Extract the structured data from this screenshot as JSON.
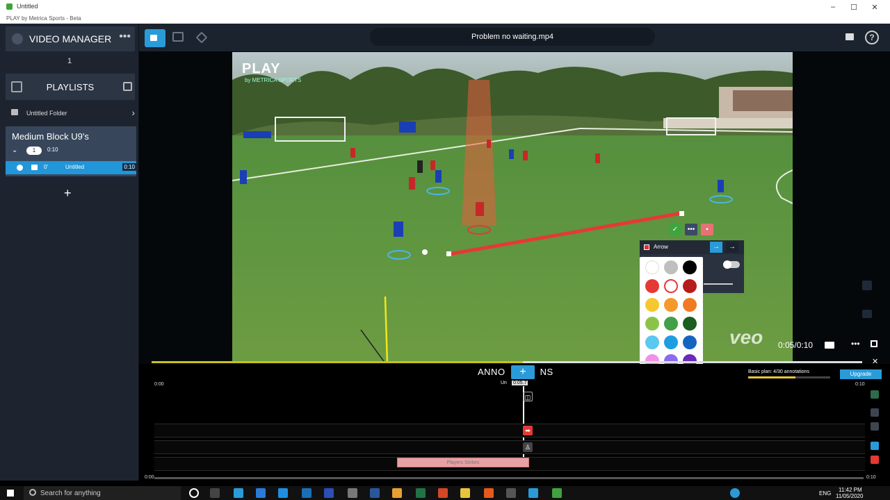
{
  "window": {
    "title": "Untitled",
    "subtitle": "PLAY by Metrica Sports - Beta",
    "min": "–",
    "max": "☐",
    "close": "✕"
  },
  "sidebar": {
    "video_manager": "VIDEO MANAGER",
    "video_count": "1",
    "playlists": "PLAYLISTS",
    "folder": "Untitled Folder",
    "playlist_name": "Medium Block U9's",
    "playlist_count": "1",
    "playlist_duration": "0:10",
    "clip_index": "0'",
    "clip_name": "Untitled",
    "clip_duration": "0:10",
    "add": "+"
  },
  "topbar": {
    "file_name": "Problem no waiting.mp4",
    "help": "?"
  },
  "player": {
    "logo_big": "PLAY",
    "logo_small": "by METRICA SPORTS",
    "watermark": "veo",
    "time": "0:05/0:10"
  },
  "arrow_panel": {
    "label": "Arrow",
    "btn1": "→",
    "btn2": "→"
  },
  "palette": {
    "colors": [
      "#ffffff",
      "#bfbfbf",
      "#000000",
      "#e53935",
      "#ffffff",
      "#b71c1c",
      "#f6c72f",
      "#f39a2b",
      "#ef7a22",
      "#8bc34a",
      "#43a047",
      "#1b5e20",
      "#5ac8f0",
      "#1e9ee0",
      "#1565c0",
      "#f48fe8",
      "#8b6cf0",
      "#6a2bb8"
    ]
  },
  "annotations": {
    "title_left": "ANNO",
    "title_right": "NS",
    "sub": "Un",
    "plus": "+",
    "playhead_time": "0:05.7",
    "start_time": "0:00",
    "end_time": "0:10",
    "plan": "Basic plan: 4/30 annotations",
    "upgrade": "Upgrade",
    "clip_label": "Players Strikes",
    "scale_start": "0:00",
    "scale_end": "0:10"
  },
  "taskbar": {
    "search": "Search for anything",
    "lang": "ENG",
    "time": "11:42 PM",
    "date": "11/05/2020"
  }
}
